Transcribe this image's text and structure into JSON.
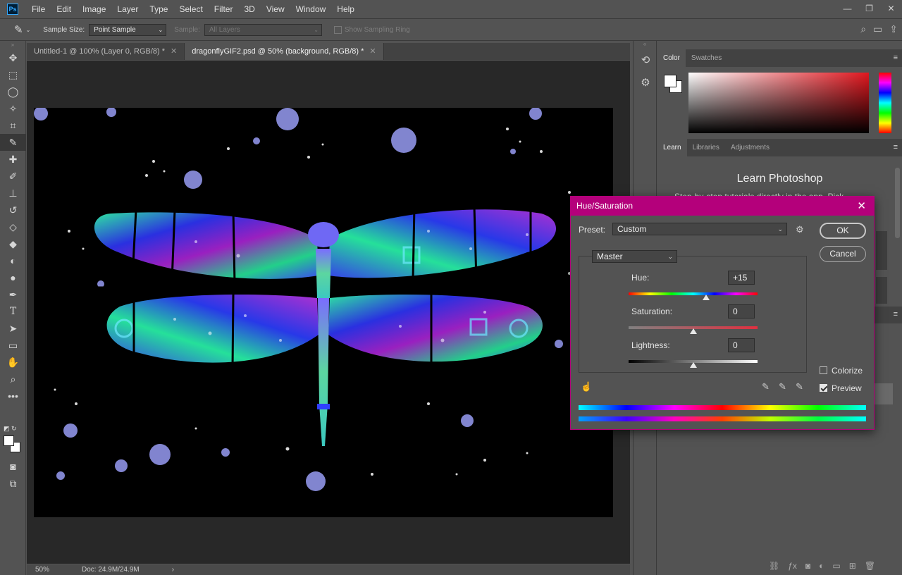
{
  "app": {
    "logo": "Ps"
  },
  "menu": [
    "File",
    "Edit",
    "Image",
    "Layer",
    "Type",
    "Select",
    "Filter",
    "3D",
    "View",
    "Window",
    "Help"
  ],
  "window_controls": {
    "minimize": "—",
    "maximize": "❐",
    "close": "✕"
  },
  "options_bar": {
    "tool_icon": "eyedropper-icon",
    "sample_size_label": "Sample Size:",
    "sample_size_value": "Point Sample",
    "sample_label": "Sample:",
    "sample_value": "All Layers",
    "sampling_ring_label": "Show Sampling Ring"
  },
  "tabs": [
    {
      "label": "Untitled-1 @ 100% (Layer 0, RGB/8) *",
      "close": "✕",
      "active": false
    },
    {
      "label": "dragonflyGIF2.psd @ 50% (background, RGB/8) *",
      "close": "✕",
      "active": true
    }
  ],
  "status_bar": {
    "zoom": "50%",
    "doc": "Doc: 24.9M/24.9M",
    "arrow": "›"
  },
  "color_panel": {
    "tabs": [
      "Color",
      "Swatches"
    ],
    "foreground": "#ffffff",
    "background": "#ffffff",
    "field_hue": "#e1171f"
  },
  "learn_panel": {
    "tabs": [
      "Learn",
      "Libraries",
      "Adjustments"
    ],
    "title": "Learn Photoshop",
    "subtitle": "Step-by-step tutorials directly in the app. Pick"
  },
  "dialog": {
    "title": "Hue/Saturation",
    "close": "✕",
    "preset_label": "Preset:",
    "preset_value": "Custom",
    "preset_gear": "⚙",
    "ok": "OK",
    "cancel": "Cancel",
    "channel": "Master",
    "hue_label": "Hue:",
    "hue_value": "+15",
    "hue_position": 0.6,
    "saturation_label": "Saturation:",
    "saturation_value": "0",
    "saturation_position": 0.5,
    "lightness_label": "Lightness:",
    "lightness_value": "0",
    "lightness_position": 0.5,
    "colorize_label": "Colorize",
    "colorize_checked": false,
    "preview_label": "Preview",
    "preview_checked": true,
    "accent": "#b4007b"
  }
}
